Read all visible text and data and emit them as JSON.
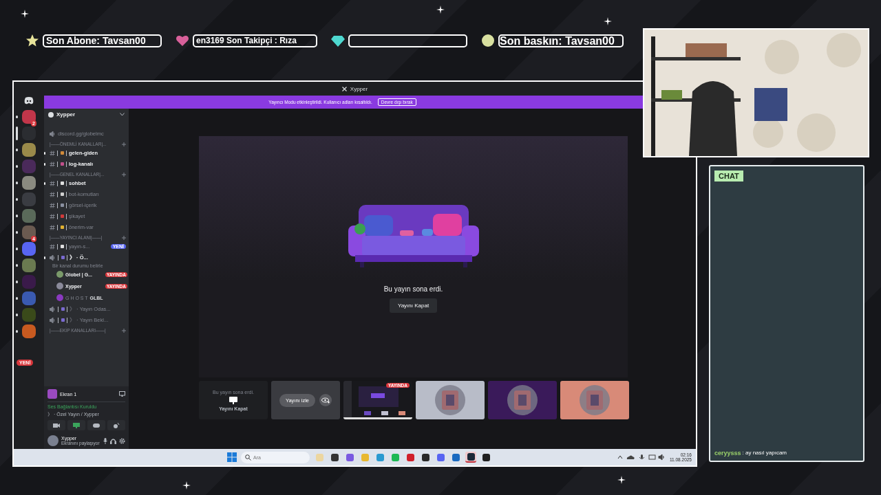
{
  "tickers": [
    {
      "kind": "star",
      "text": "Son Abone: Tavsan00"
    },
    {
      "kind": "heart",
      "text": "en3169    Son Takipçi : Rıza"
    },
    {
      "kind": "gem"
    },
    {
      "kind": "coin",
      "text": "Son baskın: Tavsan00"
    }
  ],
  "window": {
    "title": "Xypper"
  },
  "banner": {
    "text": "Yayıncı Modu etkinleştirildi. Kullanıcı adları kısaltıldı.",
    "button": "Devre dışı bırak"
  },
  "servers": [
    {
      "color": "#c2364a",
      "badge": "2",
      "selected": false
    },
    {
      "color": "#2b2d31",
      "selected": true
    },
    {
      "color": "#9a8a4a",
      "selected": false
    },
    {
      "color": "#4a2a5a",
      "selected": false
    },
    {
      "color": "#8a8a80",
      "selected": false
    },
    {
      "color": "#3a3c42",
      "selected": false
    },
    {
      "color": "#5a6a5a",
      "selected": false
    },
    {
      "color": "#6a5a50",
      "badge": "4",
      "selected": false
    },
    {
      "color": "#5865f2",
      "selected": false
    },
    {
      "color": "#6a7a50",
      "selected": false
    },
    {
      "color": "#3a1a4a",
      "selected": false
    },
    {
      "color": "#3a5ab0",
      "selected": false
    },
    {
      "color": "#3a4a1a",
      "selected": false
    },
    {
      "color": "#c85a20",
      "selected": false
    }
  ],
  "new_badge": "YENİ",
  "server_name": "Xypper",
  "channels": [
    {
      "kind": "voice",
      "name": "discord.gg/globelmc",
      "unread": false
    },
    {
      "kind": "category",
      "name": "|——ÖNEMLİ KANALLAR|..."
    },
    {
      "kind": "text",
      "name": "gelen-giden",
      "unread": true,
      "color": "#d08a3a"
    },
    {
      "kind": "text",
      "name": "log-kanalı",
      "unread": true,
      "color": "#c0508a"
    },
    {
      "kind": "category",
      "name": "|——GENEL KANALLAR|..."
    },
    {
      "kind": "text",
      "name": "sohbet",
      "unread": true,
      "color": "#e0e0e0"
    },
    {
      "kind": "text",
      "name": "bot-komutları",
      "unread": false,
      "color": "#d0d0d0"
    },
    {
      "kind": "text",
      "name": "görsel-içerik",
      "unread": false,
      "color": "#8a90a0"
    },
    {
      "kind": "text",
      "name": "şikayet",
      "unread": false,
      "color": "#d03a3a"
    },
    {
      "kind": "text",
      "name": "önerim-var",
      "unread": false,
      "color": "#e0b030"
    },
    {
      "kind": "category",
      "name": "|——YAYINCI ALANI|——|"
    },
    {
      "kind": "text",
      "name": "yayın-s...",
      "unread": false,
      "color": "#e0e0e0",
      "badge": "YENİ"
    },
    {
      "kind": "voice",
      "name": "》 · Ö...",
      "unread": true,
      "status": "Bir kanal durumu belirle",
      "color": "#7a6ad0",
      "members": [
        {
          "name": "Globel | G...",
          "live": true,
          "live_label": "YAYINDA",
          "color": "#7a9a6a"
        },
        {
          "name": "Xypper",
          "live": true,
          "live_label": "YAYINDA",
          "color": "#8a8a9a"
        },
        {
          "name": "G H O S T",
          "live": false,
          "tag": "GLBL",
          "color": "#8a3ac0"
        }
      ]
    },
    {
      "kind": "voice",
      "name": "》 · Yayın Odas...",
      "unread": false,
      "color": "#7a6ad0"
    },
    {
      "kind": "voice",
      "name": "》 · Yayın Bekl...",
      "unread": false,
      "color": "#7a6ad0"
    },
    {
      "kind": "category",
      "name": "|——EKİP KANALLARI——|"
    }
  ],
  "voice_panel": {
    "screen": "Ekran 1",
    "status": "Ses Bağlantısı Kuruldu",
    "channel": "》 · Özel Yayın / Xypper",
    "user": "Xypper",
    "activity": "Ekranını paylaşıyor"
  },
  "stream": {
    "message": "Bu yayın sona erdi.",
    "button": "Yayını Kapat"
  },
  "thumbnails": [
    {
      "kind": "ended",
      "text": "Bu yayın sona erdi.",
      "button": "Yayını Kapat"
    },
    {
      "kind": "watch",
      "button": "Yayını izle"
    },
    {
      "kind": "screen",
      "badge": "YAYINDA"
    },
    {
      "kind": "picture",
      "color": "#b8bcc8"
    },
    {
      "kind": "picture",
      "color": "#3a1a5a"
    },
    {
      "kind": "picture",
      "color": "#d88a78"
    }
  ],
  "taskbar": {
    "search": {
      "placeholder": "Ara"
    },
    "apps": [
      {
        "color": "#ecd6a0",
        "active": false
      },
      {
        "color": "#333333",
        "active": false
      },
      {
        "color": "#7a5ae0",
        "active": false
      },
      {
        "color": "#e8b830",
        "active": false
      },
      {
        "color": "#2a9ad0",
        "active": false
      },
      {
        "color": "#1db954",
        "active": false
      },
      {
        "color": "#d0202a",
        "active": false
      },
      {
        "color": "#2a2a2a",
        "active": false
      },
      {
        "color": "#5865f2",
        "active": false
      },
      {
        "color": "#1a6ac0",
        "active": false
      },
      {
        "color": "#1b2838",
        "active": true
      },
      {
        "color": "#202020",
        "active": false
      }
    ],
    "time": "02:16",
    "date": "11.08.2025"
  },
  "chat": {
    "title": "CHAT",
    "messages": [
      {
        "user": "ceryysss",
        "text": ": ay nasıl yapıcam",
        "color": "#9ad06a"
      }
    ]
  }
}
